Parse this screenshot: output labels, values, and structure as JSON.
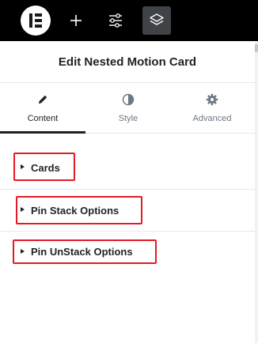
{
  "toolbar": {
    "logo_icon": "elementor-logo",
    "buttons": [
      {
        "icon": "plus-icon"
      },
      {
        "icon": "sliders-icon"
      },
      {
        "icon": "layers-icon",
        "active": true
      }
    ],
    "colors": {
      "background": "#000000",
      "active_button": "#3f4247"
    }
  },
  "panel": {
    "title": "Edit Nested Motion Card"
  },
  "tabs": [
    {
      "label": "Content",
      "icon": "pencil-icon",
      "active": true
    },
    {
      "label": "Style",
      "icon": "half-circle-icon",
      "active": false
    },
    {
      "label": "Advanced",
      "icon": "gear-icon",
      "active": false
    }
  ],
  "sections": [
    {
      "label": "Cards",
      "icon": "caret-right-icon"
    },
    {
      "label": "Pin Stack Options",
      "icon": "caret-right-icon"
    },
    {
      "label": "Pin UnStack Options",
      "icon": "caret-right-icon"
    }
  ],
  "colors": {
    "text": "#1f2124",
    "muted_text": "#6d7882",
    "divider": "#e6e8ea",
    "highlight_outline": "#e31b23"
  }
}
